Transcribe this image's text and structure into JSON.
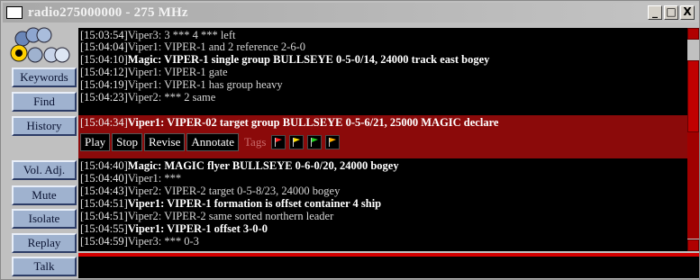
{
  "window": {
    "title": "radio275000000 - 275 MHz",
    "controls": {
      "minimize": "_",
      "maximize": "□",
      "close": "X"
    }
  },
  "sidebar": {
    "logo_icon": "radio-logo-icon",
    "buttons": {
      "keywords": "Keywords",
      "find": "Find",
      "history": "History",
      "vol_adj": "Vol. Adj.",
      "mute": "Mute",
      "isolate": "Isolate",
      "replay": "Replay",
      "talk": "Talk"
    }
  },
  "log": {
    "lines": [
      {
        "time": "[15:03:54]",
        "text": "Viper3: 3 *** 4 *** left"
      },
      {
        "time": "[15:04:04]",
        "text": "Viper1: VIPER-1 and 2 reference 2-6-0"
      },
      {
        "time": "[15:04:10]",
        "text": "Magic: VIPER-1 single group BULLSEYE 0-5-0/14, 24000 track east bogey"
      },
      {
        "time": "[15:04:12]",
        "text": "Viper1: VIPER-1 gate"
      },
      {
        "time": "[15:04:19]",
        "text": "Viper1: VIPER-1 has group heavy"
      },
      {
        "time": "[15:04:23]",
        "text": "Viper2: *** 2 same"
      },
      {
        "time": "[15:04:34]",
        "text": "Viper1: VIPER-02 target group BULLSEYE 0-5-6/21, 25000 MAGIC declare"
      },
      {
        "time": "[15:04:40]",
        "text": "Magic: MAGIC flyer BULLSEYE 0-6-0/20, 24000 bogey"
      },
      {
        "time": "[15:04:40]",
        "text": "Viper1: ***"
      },
      {
        "time": "[15:04:43]",
        "text": "Viper2: VIPER-2 target 0-5-8/23, 24000 bogey"
      },
      {
        "time": "[15:04:51]",
        "text": "Viper1: VIPER-1 formation is offset container 4 ship"
      },
      {
        "time": "[15:04:51]",
        "text": "Viper2: VIPER-2 same sorted northern leader"
      },
      {
        "time": "[15:04:55]",
        "text": "Viper1: VIPER-1 offset 3-0-0"
      },
      {
        "time": "[15:04:59]",
        "text": "Viper3: *** 0-3"
      }
    ],
    "selected_index": 6
  },
  "toolbar": {
    "play": "Play",
    "stop": "Stop",
    "revise": "Revise",
    "annotate": "Annotate",
    "tags": "Tags",
    "flags": [
      {
        "icon": "flag-icon",
        "color": "#ff2020"
      },
      {
        "icon": "flag-icon",
        "color": "#ffe000"
      },
      {
        "icon": "flag-icon",
        "color": "#20d020"
      },
      {
        "icon": "flag-icon",
        "color": "#ffb000"
      }
    ]
  },
  "colors": {
    "selected_row": "#8b0a0a",
    "accent_red": "#d40000",
    "button_blue": "#9fb2cf"
  }
}
